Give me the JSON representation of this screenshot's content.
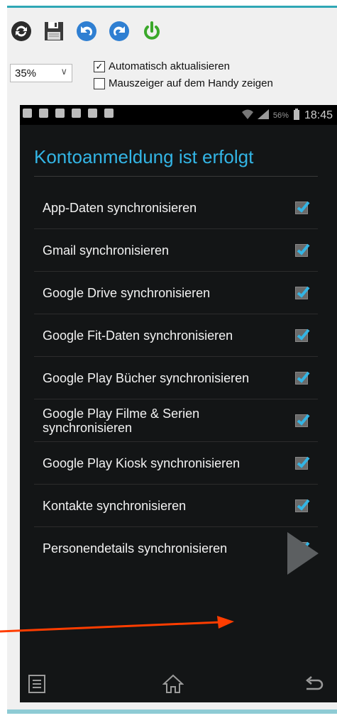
{
  "colors": {
    "accent": "#33b5e5",
    "toolbar_green": "#3aa82a",
    "toolbar_blue": "#2f7fd2",
    "arrow": "#ff3d00",
    "frame_border": "#2fa7b5"
  },
  "toolbar": {
    "buttons": [
      "refresh-icon",
      "save-icon",
      "undo-icon",
      "redo-icon",
      "power-icon"
    ]
  },
  "controls": {
    "zoom_value": "35%",
    "auto_update_label": "Automatisch aktualisieren",
    "auto_update_checked": true,
    "show_cursor_label": "Mauszeiger auf dem Handy zeigen",
    "show_cursor_checked": false
  },
  "statusbar": {
    "battery": "56%",
    "time": "18:45"
  },
  "screen": {
    "title": "Kontoanmeldung ist erfolgt",
    "items": [
      {
        "label": "App-Daten synchronisieren",
        "checked": true
      },
      {
        "label": "Gmail synchronisieren",
        "checked": true
      },
      {
        "label": "Google Drive synchronisieren",
        "checked": true
      },
      {
        "label": "Google Fit-Daten synchronisieren",
        "checked": true
      },
      {
        "label": "Google Play Bücher synchronisieren",
        "checked": true
      },
      {
        "label": "Google Play Filme & Serien synchronisieren",
        "checked": true
      },
      {
        "label": "Google Play Kiosk synchronisieren",
        "checked": true
      },
      {
        "label": "Kontakte synchronisieren",
        "checked": true
      },
      {
        "label": "Personendetails synchronisieren",
        "checked": true
      }
    ]
  },
  "navbar": {
    "buttons": [
      "menu-icon",
      "home-icon",
      "back-icon"
    ]
  }
}
